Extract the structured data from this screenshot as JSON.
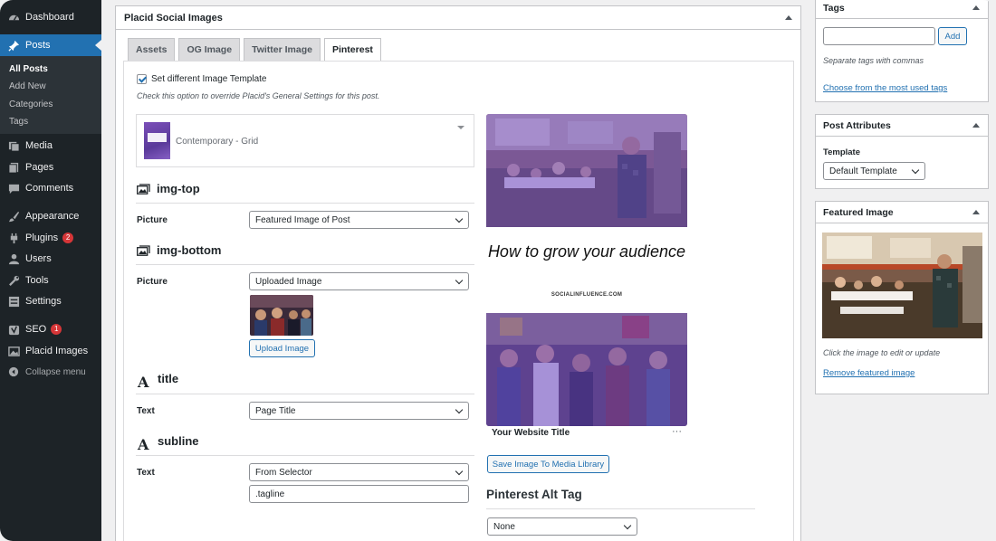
{
  "sidebar": {
    "items": [
      {
        "label": "Dashboard",
        "icon": "dashboard-icon"
      },
      {
        "label": "Posts",
        "icon": "pin-icon",
        "active": true
      },
      {
        "label": "Media",
        "icon": "media-icon"
      },
      {
        "label": "Pages",
        "icon": "pages-icon"
      },
      {
        "label": "Comments",
        "icon": "comments-icon"
      },
      {
        "label": "Appearance",
        "icon": "brush-icon"
      },
      {
        "label": "Plugins",
        "icon": "plugins-icon",
        "badge": "2"
      },
      {
        "label": "Users",
        "icon": "users-icon"
      },
      {
        "label": "Tools",
        "icon": "tools-icon"
      },
      {
        "label": "Settings",
        "icon": "settings-icon"
      },
      {
        "label": "SEO",
        "icon": "seo-icon",
        "badge": "1"
      },
      {
        "label": "Placid Images",
        "icon": "images-icon"
      }
    ],
    "submenu": [
      "All Posts",
      "Add New",
      "Categories",
      "Tags"
    ],
    "collapse_label": "Collapse menu"
  },
  "metabox": {
    "title": "Placid Social Images",
    "tabs": [
      "Assets",
      "OG Image",
      "Twitter Image",
      "Pinterest"
    ],
    "checkbox_label": "Set different Image Template",
    "help_text": "Check this option to override Placid's General Settings for this post.",
    "template_name": "Contemporary - Grid",
    "sections": {
      "img_top": {
        "title": "img-top",
        "label": "Picture",
        "value": "Featured Image of Post"
      },
      "img_bottom": {
        "title": "img-bottom",
        "label": "Picture",
        "value": "Uploaded Image",
        "button": "Upload Image"
      },
      "title": {
        "title": "title",
        "label": "Text",
        "value": "Page Title"
      },
      "subline": {
        "title": "subline",
        "label": "Text",
        "value": "From Selector",
        "selector": ".tagline"
      }
    },
    "preview": {
      "headline": "How to grow your audience",
      "url": "SOCIALINFLUENCE.COM",
      "caption": "Your Website Title",
      "more": "···",
      "save_button": "Save Image To Media Library",
      "alt_tag_title": "Pinterest Alt Tag",
      "alt_tag_value": "None"
    }
  },
  "tags_box": {
    "title": "Tags",
    "add_button": "Add",
    "hint": "Separate tags with commas",
    "link": "Choose from the most used tags"
  },
  "attributes_box": {
    "title": "Post Attributes",
    "template_label": "Template",
    "template_value": "Default Template"
  },
  "featured_box": {
    "title": "Featured Image",
    "hint": "Click the image to edit or update",
    "remove_link": "Remove featured image"
  },
  "colors": {
    "accent": "#2271b1",
    "sidebar": "#1d2327",
    "badge": "#d63638",
    "overlay": "#7048c8"
  }
}
